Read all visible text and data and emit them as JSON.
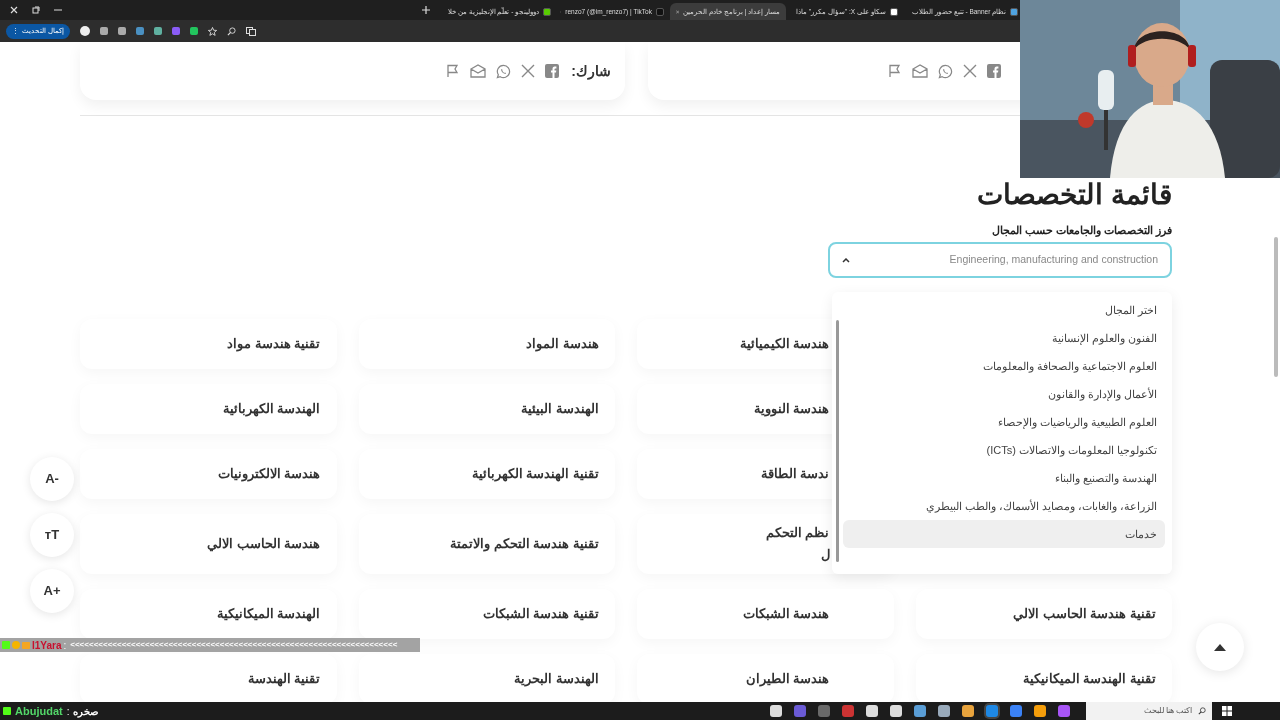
{
  "browser": {
    "tabs": [
      {
        "title": "نظام Banner - تتبع حضور الطلاب",
        "selected": false,
        "color": "#4fa3e0"
      },
      {
        "title": "سكاو على X: \"سؤال مكرر\" ماذا",
        "selected": false,
        "color": "#ffffff"
      },
      {
        "title": "مسار إعداد | برنامج خادم الحرمين",
        "selected": true
      },
      {
        "title": "renzo7 (@im_renzo7) | TikTok",
        "selected": false,
        "color": "#111111"
      },
      {
        "title": "دوولينجو - تعلّم الإنجليزية من خلا",
        "selected": false,
        "color": "#58cc02"
      }
    ],
    "update_button": "إكمال التحديث",
    "update_menu": "⋮"
  },
  "share_card": {
    "label": "شارك:"
  },
  "heading": "قائمة التخصصات",
  "filter": {
    "label": "فرز التخصصات والجامعات حسب المجال",
    "value": "Engineering, manufacturing and construction",
    "expanded": true,
    "options": [
      {
        "label": "اختر المجال",
        "highlighted": false
      },
      {
        "label": "الفنون والعلوم الإنسانية",
        "highlighted": false
      },
      {
        "label": "العلوم الاجتماعية والصحافة والمعلومات",
        "highlighted": false
      },
      {
        "label": "الأعمال والإدارة والقانون",
        "highlighted": false
      },
      {
        "label": "العلوم الطبيعية والرياضيات والإحصاء",
        "highlighted": false
      },
      {
        "label": "تكنولوجيا المعلومات والاتصالات (ICTs)",
        "highlighted": false
      },
      {
        "label": "الهندسة والتصنيع والبناء",
        "highlighted": false
      },
      {
        "label": "الزراعة، والغابات، ومصايد الأسماك، والطب البيطري",
        "highlighted": false
      },
      {
        "label": "خدمات",
        "highlighted": true
      }
    ]
  },
  "majors": [
    [
      "هندسة الكيميائية",
      "هندسة المواد",
      "تقنية هندسة مواد"
    ],
    [
      "هندسة النووية",
      "الهندسة البيئية",
      "الهندسة الكهربائية"
    ],
    [
      "ندسة الطاقة",
      "تقنية الهندسة الكهربائية",
      "هندسة الالكترونيات"
    ],
    [
      "نظم التحكم\nل",
      "تقنية هندسة التحكم والاتمتة",
      "هندسة الحاسب الالي"
    ],
    [
      "تقنية هندسة الحاسب الالي",
      "هندسة الشبكات",
      "تقنية هندسة الشبكات",
      "الهندسة الميكانيكية"
    ],
    [
      "تقنية الهندسة الميكانيكية",
      "هندسة الطيران",
      "الهندسة البحرية",
      "تقنية الهندسة"
    ]
  ],
  "font_controls": [
    "A-",
    "тT",
    "A+"
  ],
  "chat": {
    "user": "I1Yara",
    "separator": ":",
    "message": "<<<<<<<<<<<<<<<<<<<<<<<<<<<<<<<<<<<<<<<<<<<<<<<<<<<<<<<<<<<<<<<<<<<<<<"
  },
  "taskbar_chat": {
    "user": "Abujudat",
    "separator": ":",
    "message": "صخره"
  },
  "taskbar": {
    "search_placeholder": "اكتب هنا للبحث"
  }
}
